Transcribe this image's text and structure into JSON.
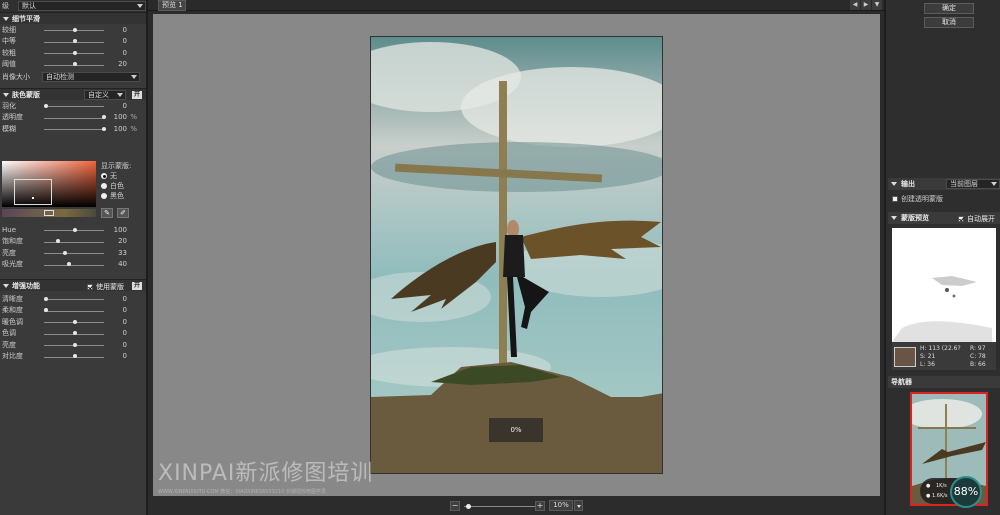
{
  "left_panel": {
    "preset": {
      "label": "级",
      "value": "默认"
    },
    "detail_section": {
      "title": "细节平滑",
      "sliders": [
        {
          "name": "较细",
          "value": "0",
          "pos": 0.5
        },
        {
          "name": "中等",
          "value": "0",
          "pos": 0.5
        },
        {
          "name": "较粗",
          "value": "0",
          "pos": 0.5
        },
        {
          "name": "阈值",
          "value": "20",
          "pos": 0.5
        }
      ],
      "image_size": {
        "label": "肖像大小",
        "value": "自动检测"
      }
    },
    "skin_mask": {
      "title": "肤色蒙版",
      "mode": "自定义",
      "toggle": "开",
      "sliders": [
        {
          "name": "羽化",
          "value": "0",
          "unit": "",
          "pos": 0.0
        },
        {
          "name": "透明度",
          "value": "100",
          "unit": "%",
          "pos": 1.0
        },
        {
          "name": "模糊",
          "value": "100",
          "unit": "%",
          "pos": 1.0
        }
      ],
      "show_mask": {
        "label": "显示蒙版:",
        "options": [
          {
            "label": "无",
            "selected": true
          },
          {
            "label": "白色",
            "selected": false
          },
          {
            "label": "黑色",
            "selected": false
          }
        ]
      },
      "color_sliders": [
        {
          "name": "Hue",
          "value": "100",
          "pos": 0.5
        },
        {
          "name": "饱和度",
          "value": "20",
          "pos": 0.2
        },
        {
          "name": "亮度",
          "value": "33",
          "pos": 0.33
        },
        {
          "name": "吸光度",
          "value": "40",
          "pos": 0.4
        }
      ]
    },
    "enhance": {
      "title": "增强功能",
      "use_mask_label": "使用蒙版",
      "use_mask_checked": true,
      "toggle": "开",
      "sliders": [
        {
          "name": "清晰度",
          "value": "0",
          "pos": 0.0
        },
        {
          "name": "柔和度",
          "value": "0",
          "pos": 0.0
        },
        {
          "name": "暖色调",
          "value": "0",
          "pos": 0.5
        },
        {
          "name": "色调",
          "value": "0",
          "pos": 0.5
        },
        {
          "name": "亮度",
          "value": "0",
          "pos": 0.5
        },
        {
          "name": "对比度",
          "value": "0",
          "pos": 0.5
        }
      ]
    }
  },
  "preview": {
    "tab_label": "预览 1",
    "progress": "0%",
    "zoom_value": "10%",
    "zoom_pos": 0.03
  },
  "watermark": {
    "main": "XINPAI新派修图培训",
    "sub": "WWW.XINPAIXIUTU.COM  微信：XIAOXIN656553210 长期招收修图学员"
  },
  "right_panel": {
    "ok_label": "确定",
    "cancel_label": "取消",
    "output": {
      "title": "输出",
      "value": "当前图层"
    },
    "create_mask_label": "创建透明蒙版",
    "mask_preview": {
      "title": "蒙版预览",
      "auto_label": "自动展开"
    },
    "info": {
      "h": "H: 113 (22.6?",
      "s": "S:  21",
      "l": "L:  36",
      "r": "R:  97",
      "c": "C:  78",
      "b": "B:  66"
    },
    "navigator_title": "导航器",
    "net_up": "1K/s",
    "net_down": "1.6K/s",
    "gauge": "88%"
  },
  "colors": {
    "accent_red": "#dd2222",
    "sky_teal": "#6fa8a6",
    "swatch": "#6a5446"
  }
}
